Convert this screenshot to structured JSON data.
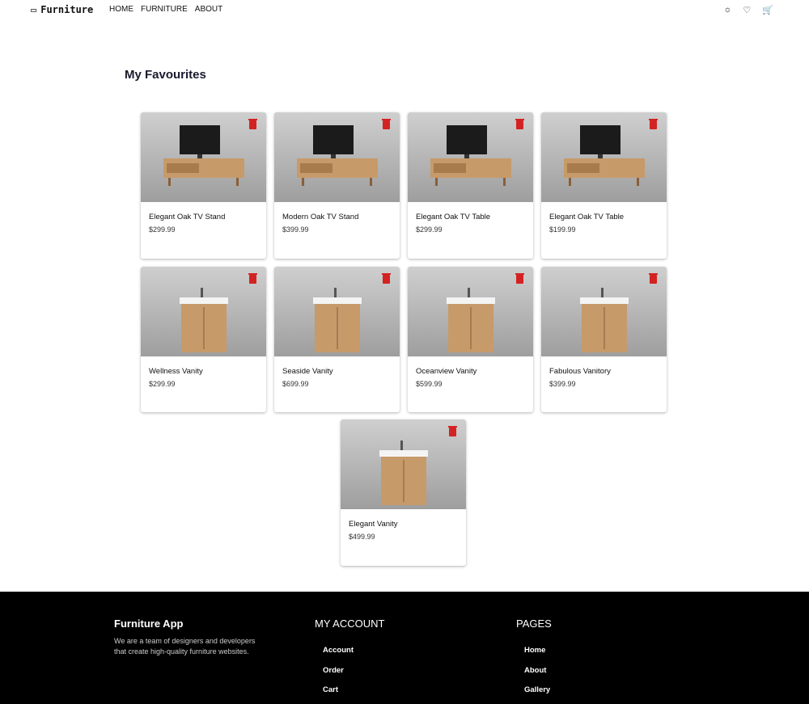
{
  "nav": {
    "brand": "Furniture",
    "links": [
      "HOME",
      "FURNITURE",
      "ABOUT"
    ]
  },
  "page_title": "My Favourites",
  "products": [
    {
      "name": "Elegant Oak TV Stand",
      "price": "$299.99",
      "kind": "tv"
    },
    {
      "name": "Modern Oak TV Stand",
      "price": "$399.99",
      "kind": "tv"
    },
    {
      "name": "Elegant Oak TV Table",
      "price": "$299.99",
      "kind": "tv"
    },
    {
      "name": "Elegant Oak TV Table",
      "price": "$199.99",
      "kind": "tv"
    },
    {
      "name": "Wellness Vanity",
      "price": "$299.99",
      "kind": "vanity"
    },
    {
      "name": "Seaside Vanity",
      "price": "$699.99",
      "kind": "vanity"
    },
    {
      "name": "Oceanview Vanity",
      "price": "$599.99",
      "kind": "vanity"
    },
    {
      "name": "Fabulous Vanitory",
      "price": "$399.99",
      "kind": "vanity"
    },
    {
      "name": "Elegant Vanity",
      "price": "$499.99",
      "kind": "vanity"
    }
  ],
  "footer": {
    "brand": "Furniture App",
    "description": "We are a team of designers and developers that create high-quality furniture websites.",
    "account_title": "MY ACCOUNT",
    "account_links": [
      "Account",
      "Order",
      "Cart"
    ],
    "pages_title": "PAGES",
    "pages_links": [
      "Home",
      "About",
      "Gallery"
    ]
  }
}
